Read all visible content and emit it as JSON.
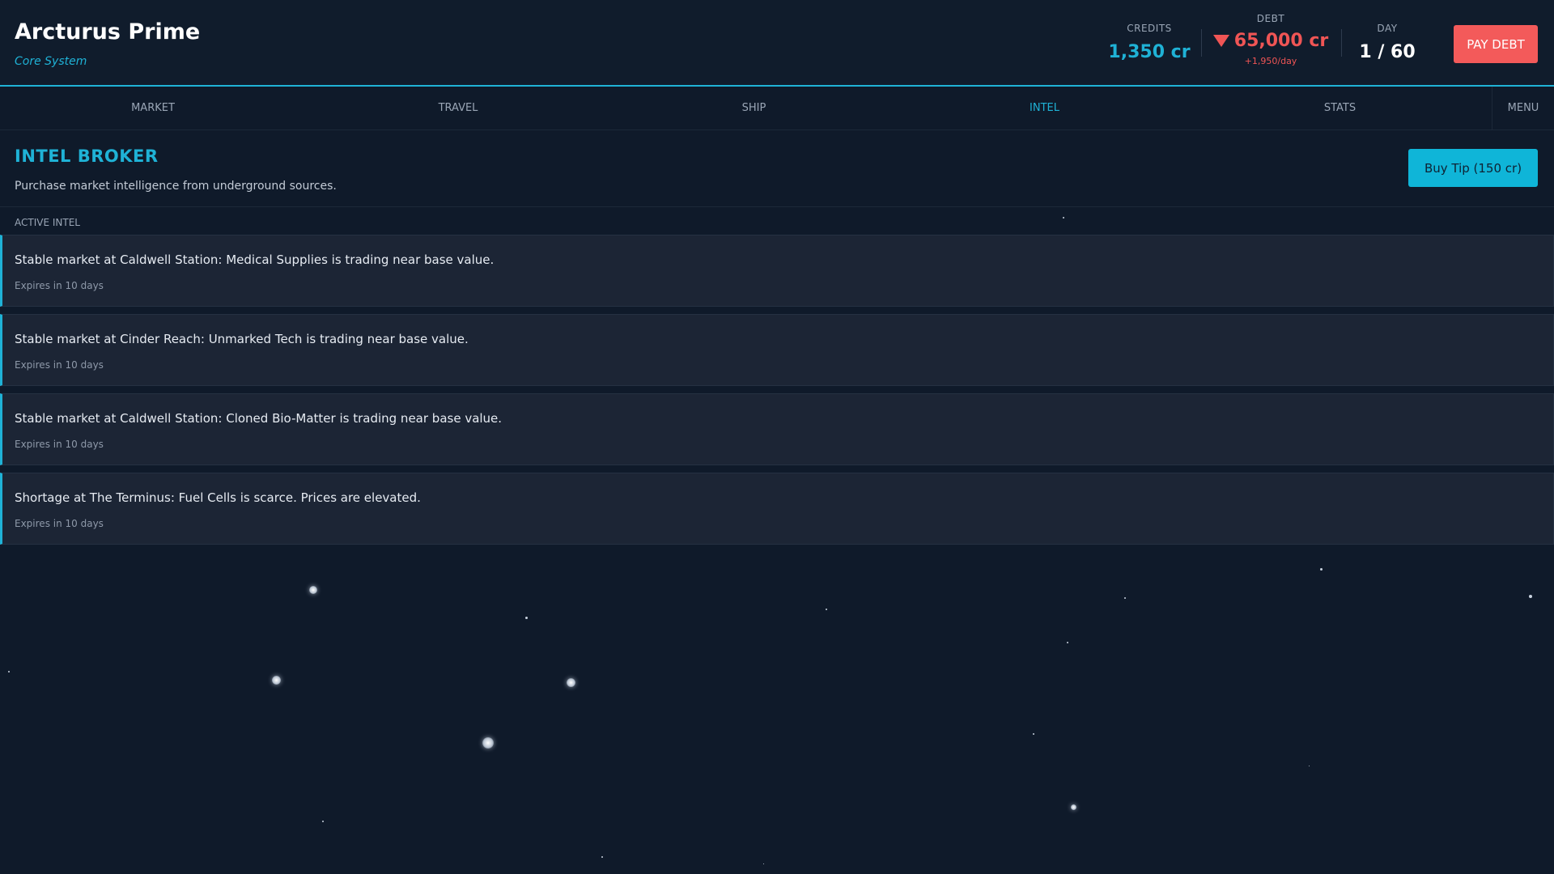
{
  "header": {
    "location": "Arcturus Prime",
    "region": "Core System",
    "credits_label": "CREDITS",
    "credits_value": "1,350 cr",
    "debt_label": "DEBT",
    "debt_value": "65,000 cr",
    "debt_rate": "+1,950/day",
    "debt_icon": "triangle-down-icon",
    "day_label": "DAY",
    "day_value": "1 / 60",
    "pay_debt_label": "PAY DEBT"
  },
  "nav": {
    "tabs": [
      {
        "label": "MARKET",
        "active": false
      },
      {
        "label": "TRAVEL",
        "active": false
      },
      {
        "label": "SHIP",
        "active": false
      },
      {
        "label": "INTEL",
        "active": true
      },
      {
        "label": "STATS",
        "active": false
      }
    ],
    "menu_label": "MENU"
  },
  "intel": {
    "title": "INTEL BROKER",
    "description": "Purchase market intelligence from underground sources.",
    "buy_label": "Buy Tip (150 cr)",
    "section_label": "ACTIVE INTEL",
    "items": [
      {
        "text": "Stable market at Caldwell Station: Medical Supplies is trading near base value.",
        "expires": "Expires in 10 days"
      },
      {
        "text": "Stable market at Cinder Reach: Unmarked Tech is trading near base value.",
        "expires": "Expires in 10 days"
      },
      {
        "text": "Stable market at Caldwell Station: Cloned Bio-Matter is trading near base value.",
        "expires": "Expires in 10 days"
      },
      {
        "text": "Shortage at The Terminus: Fuel Cells is scarce. Prices are elevated.",
        "expires": "Expires in 10 days"
      }
    ]
  },
  "colors": {
    "accent": "#1fb2d6",
    "danger": "#f05555",
    "background": "#0f1a2a",
    "card": "#1c2535"
  }
}
